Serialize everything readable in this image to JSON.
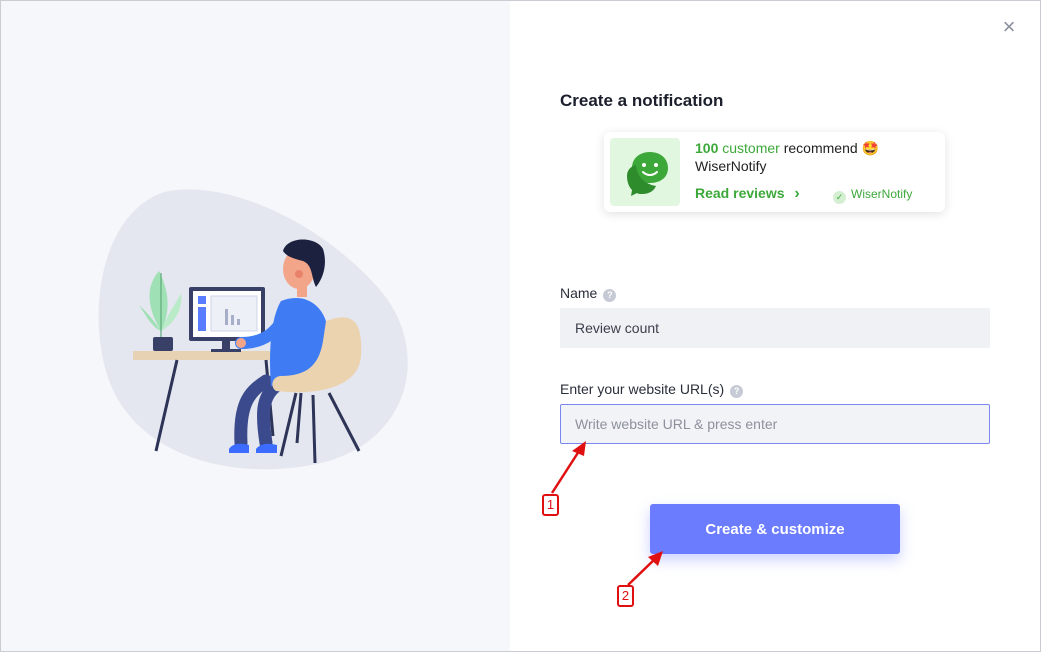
{
  "dialog": {
    "title": "Create a notification",
    "close_icon": "close-icon"
  },
  "preview": {
    "count": "100",
    "customer_word": "customer",
    "recommend_text": "recommend",
    "emoji": "🤩",
    "brand_name": "WiserNotify",
    "link_label": "Read reviews",
    "link_chevron": "›",
    "badge_label": "WiserNotify",
    "badge_check": "✓",
    "logo_icon": "chat-bubbles-icon"
  },
  "form": {
    "name_label": "Name",
    "name_value": "Review count",
    "url_label": "Enter your website URL(s)",
    "url_placeholder": "Write website URL & press enter",
    "url_value": "",
    "help_glyph": "?",
    "submit_label": "Create & customize"
  },
  "annotations": [
    {
      "label": "1"
    },
    {
      "label": "2"
    }
  ],
  "colors": {
    "accent": "#6c7cff",
    "brand_green": "#3da83a",
    "annotation_red": "#e01010"
  }
}
